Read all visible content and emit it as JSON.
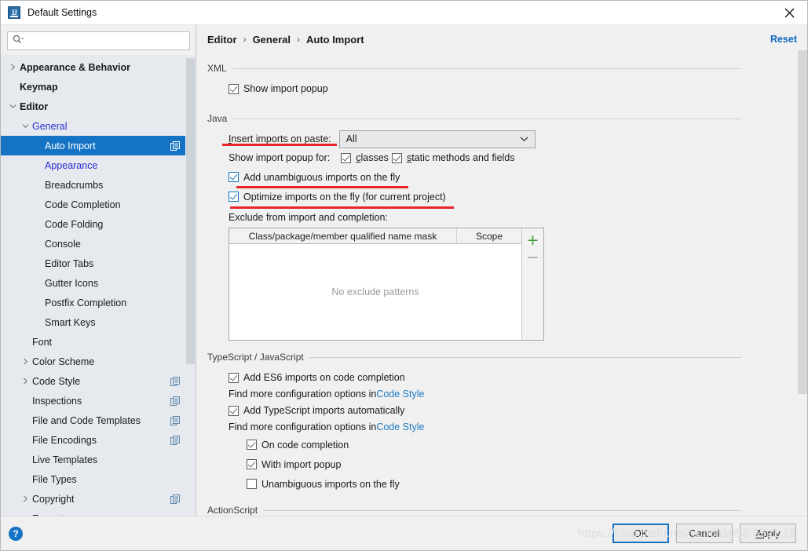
{
  "window": {
    "title": "Default Settings",
    "app_icon": "intellij-idea-icon",
    "close_icon": "close-icon"
  },
  "sidebar": {
    "search": {
      "placeholder": "",
      "value": "",
      "icon": "search-icon"
    },
    "items": [
      {
        "label": "Appearance & Behavior",
        "indent": 0,
        "arrow": "right",
        "bold": true,
        "modified": false,
        "selected": false,
        "badge": false
      },
      {
        "label": "Keymap",
        "indent": 0,
        "arrow": "none",
        "bold": true,
        "modified": false,
        "selected": false,
        "badge": false
      },
      {
        "label": "Editor",
        "indent": 0,
        "arrow": "down",
        "bold": true,
        "modified": false,
        "selected": false,
        "badge": false
      },
      {
        "label": "General",
        "indent": 1,
        "arrow": "down",
        "bold": false,
        "modified": true,
        "selected": false,
        "badge": false
      },
      {
        "label": "Auto Import",
        "indent": 2,
        "arrow": "none",
        "bold": false,
        "modified": false,
        "selected": true,
        "badge": true
      },
      {
        "label": "Appearance",
        "indent": 2,
        "arrow": "none",
        "bold": false,
        "modified": true,
        "selected": false,
        "badge": false
      },
      {
        "label": "Breadcrumbs",
        "indent": 2,
        "arrow": "none",
        "bold": false,
        "modified": false,
        "selected": false,
        "badge": false
      },
      {
        "label": "Code Completion",
        "indent": 2,
        "arrow": "none",
        "bold": false,
        "modified": false,
        "selected": false,
        "badge": false
      },
      {
        "label": "Code Folding",
        "indent": 2,
        "arrow": "none",
        "bold": false,
        "modified": false,
        "selected": false,
        "badge": false
      },
      {
        "label": "Console",
        "indent": 2,
        "arrow": "none",
        "bold": false,
        "modified": false,
        "selected": false,
        "badge": false
      },
      {
        "label": "Editor Tabs",
        "indent": 2,
        "arrow": "none",
        "bold": false,
        "modified": false,
        "selected": false,
        "badge": false
      },
      {
        "label": "Gutter Icons",
        "indent": 2,
        "arrow": "none",
        "bold": false,
        "modified": false,
        "selected": false,
        "badge": false
      },
      {
        "label": "Postfix Completion",
        "indent": 2,
        "arrow": "none",
        "bold": false,
        "modified": false,
        "selected": false,
        "badge": false
      },
      {
        "label": "Smart Keys",
        "indent": 2,
        "arrow": "none",
        "bold": false,
        "modified": false,
        "selected": false,
        "badge": false
      },
      {
        "label": "Font",
        "indent": 1,
        "arrow": "none",
        "bold": false,
        "modified": false,
        "selected": false,
        "badge": false
      },
      {
        "label": "Color Scheme",
        "indent": 1,
        "arrow": "right",
        "bold": false,
        "modified": false,
        "selected": false,
        "badge": false
      },
      {
        "label": "Code Style",
        "indent": 1,
        "arrow": "right",
        "bold": false,
        "modified": false,
        "selected": false,
        "badge": true
      },
      {
        "label": "Inspections",
        "indent": 1,
        "arrow": "none",
        "bold": false,
        "modified": false,
        "selected": false,
        "badge": true
      },
      {
        "label": "File and Code Templates",
        "indent": 1,
        "arrow": "none",
        "bold": false,
        "modified": false,
        "selected": false,
        "badge": true
      },
      {
        "label": "File Encodings",
        "indent": 1,
        "arrow": "none",
        "bold": false,
        "modified": false,
        "selected": false,
        "badge": true
      },
      {
        "label": "Live Templates",
        "indent": 1,
        "arrow": "none",
        "bold": false,
        "modified": false,
        "selected": false,
        "badge": false
      },
      {
        "label": "File Types",
        "indent": 1,
        "arrow": "none",
        "bold": false,
        "modified": false,
        "selected": false,
        "badge": false
      },
      {
        "label": "Copyright",
        "indent": 1,
        "arrow": "right",
        "bold": false,
        "modified": false,
        "selected": false,
        "badge": true
      },
      {
        "label": "Emmet",
        "indent": 1,
        "arrow": "right",
        "bold": false,
        "modified": false,
        "selected": false,
        "badge": false
      }
    ]
  },
  "main": {
    "breadcrumb": [
      "Editor",
      "General",
      "Auto Import"
    ],
    "breadcrumb_separator": "›",
    "reset_label": "Reset",
    "sections": {
      "xml": {
        "title": "XML",
        "show_import_popup": {
          "label": "Show import popup",
          "checked": true,
          "style": "gray"
        }
      },
      "java": {
        "title": "Java",
        "insert_imports_label": "Insert imports on paste:",
        "insert_imports_value": "All",
        "insert_imports_options": [
          "All"
        ],
        "show_popup_for_label": "Show import popup for:",
        "classes": {
          "label": "classes",
          "checked": true,
          "style": "gray"
        },
        "static_methods": {
          "label": "static methods and fields",
          "checked": true,
          "style": "gray"
        },
        "add_unambiguous": {
          "label": "Add unambiguous imports on the fly",
          "checked": true,
          "style": "blue"
        },
        "optimize_imports": {
          "label": "Optimize imports on the fly (for current project)",
          "checked": true,
          "style": "blue"
        },
        "exclude_label": "Exclude from import and completion:",
        "table": {
          "columns": [
            "Class/package/member qualified name mask",
            "Scope"
          ],
          "rows": [],
          "empty_text": "No exclude patterns",
          "add_button": "+",
          "remove_button": "−"
        }
      },
      "ts_js": {
        "title": "TypeScript / JavaScript",
        "add_es6": {
          "label": "Add ES6 imports on code completion",
          "checked": true,
          "style": "gray"
        },
        "hint1_prefix": "Find more configuration options in ",
        "hint1_link": "Code Style",
        "add_ts": {
          "label": "Add TypeScript imports automatically",
          "checked": true,
          "style": "gray"
        },
        "hint2_prefix": "Find more configuration options in ",
        "hint2_link": "Code Style",
        "on_code_completion": {
          "label": "On code completion",
          "checked": true,
          "style": "gray"
        },
        "with_import_popup": {
          "label": "With import popup",
          "checked": true,
          "style": "gray"
        },
        "unambiguous_fly": {
          "label": "Unambiguous imports on the fly",
          "checked": false,
          "style": "gray"
        }
      },
      "actionscript": {
        "title": "ActionScript"
      }
    }
  },
  "footer": {
    "help_label": "?",
    "ok_label": "OK",
    "cancel_label": "Cancel",
    "apply_label": "Apply"
  },
  "watermark": "https://blog.csdn.net/yumin1058 3521 19",
  "colors": {
    "accent": "#1473c4",
    "selection": "#1473c4",
    "link": "#1f7ac0",
    "modified_node": "#2b2bd0",
    "annotation_red": "#e8262a",
    "sidebar_bg": "#e6eaee",
    "panel_bg": "#f0f0f0"
  }
}
